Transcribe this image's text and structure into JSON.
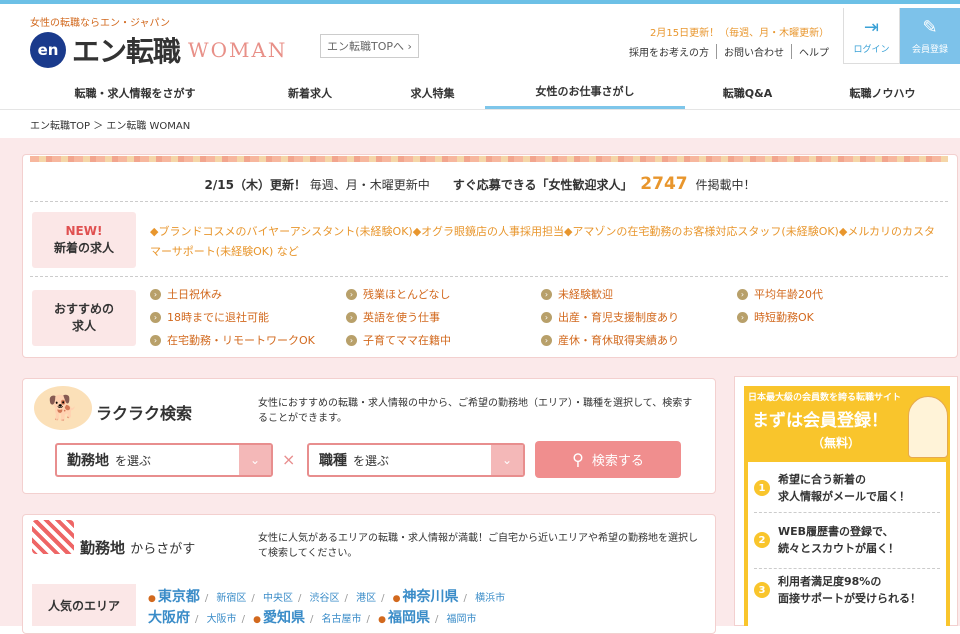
{
  "header": {
    "tagline": "女性の転職ならエン・ジャパン",
    "logo_en": "en",
    "logo_text": "エン転職",
    "logo_woman": "WOMAN",
    "top_link": "エン転職TOPへ",
    "update_note": "2月15日更新！（毎週、月・木曜更新）",
    "util_links": [
      "採用をお考えの方",
      "お問い合わせ",
      "ヘルプ"
    ],
    "login": "ログイン",
    "register": "会員登録"
  },
  "nav": {
    "items": [
      {
        "label": "転職・求人情報をさがす"
      },
      {
        "label": "新着求人"
      },
      {
        "label": "求人特集"
      },
      {
        "label": "女性のお仕事さがし"
      },
      {
        "label": "転職Q&A"
      },
      {
        "label": "転職ノウハウ"
      }
    ]
  },
  "breadcrumb": "エン転職TOP ＞ エン転職 WOMAN",
  "headline": {
    "date": "2/15（木）更新！",
    "freq": "毎週、月・木曜更新中",
    "pre": "すぐ応募できる「女性歓迎求人」",
    "count": "2747",
    "post": "件掲載中！"
  },
  "new_jobs": {
    "label_new": "NEW!",
    "label": "新着の求人",
    "text": "◆ブランドコスメのバイヤーアシスタント(未経験OK)◆オグラ眼鏡店の人事採用担当◆アマゾンの在宅勤務のお客様対応スタッフ(未経験OK)◆メルカリのカスタマーサポート(未経験OK) など"
  },
  "recommend": {
    "label1": "おすすめの",
    "label2": "求人",
    "tags": [
      "土日祝休み",
      "残業ほとんどなし",
      "未経験歓迎",
      "平均年齢20代",
      "18時までに退社可能",
      "英語を使う仕事",
      "出産・育児支援制度あり",
      "時短勤務OK",
      "在宅勤務・リモートワークOK",
      "子育てママ在籍中",
      "産休・育休取得実績あり"
    ]
  },
  "rakuraku": {
    "title": "ラクラク検索",
    "desc": "女性におすすめの転職・求人情報の中から、ご希望の勤務地（エリア）・職種を選択して、検索することができます。",
    "area_label": "勤務地",
    "area_sub": "を選ぶ",
    "job_label": "職種",
    "job_sub": "を選ぶ",
    "times": "×",
    "search": "検索する"
  },
  "area_search": {
    "title": "勤務地",
    "title_sub": "からさがす",
    "desc": "女性に人気があるエリアの転職・求人情報が満載！ご自宅から近いエリアや希望の勤務地を選択して検索してください。",
    "popular": "人気のエリア",
    "row1": [
      {
        "name": "東京都",
        "big": true
      },
      {
        "name": "新宿区"
      },
      {
        "name": "中央区"
      },
      {
        "name": "渋谷区"
      },
      {
        "name": "港区"
      },
      {
        "name": "神奈川県",
        "big": true
      },
      {
        "name": "横浜市"
      }
    ],
    "row2": [
      {
        "name": "大阪府",
        "big": true
      },
      {
        "name": "大阪市"
      },
      {
        "name": "愛知県",
        "big": true
      },
      {
        "name": "名古屋市"
      },
      {
        "name": "福岡県",
        "big": true
      },
      {
        "name": "福岡市"
      }
    ]
  },
  "sidebar": {
    "small": "日本最大級の会員数を誇る転職サイト",
    "big": "まずは会員登録！",
    "free": "（無料）",
    "benefits": [
      {
        "num": "1",
        "line1": "希望に合う新着の",
        "line2": "求人情報がメールで届く！"
      },
      {
        "num": "2",
        "line1": "WEB履歴書の登録で、",
        "line2": "続々とスカウトが届く！"
      },
      {
        "num": "3",
        "line1": "利用者満足度98%の",
        "line2": "面接サポートが受けられる！"
      }
    ]
  },
  "colors": {
    "accent_blue": "#6cc0e6",
    "accent_orange": "#e8962d",
    "accent_pink": "#f08e8e",
    "sidebar_yellow": "#f9c52c"
  }
}
